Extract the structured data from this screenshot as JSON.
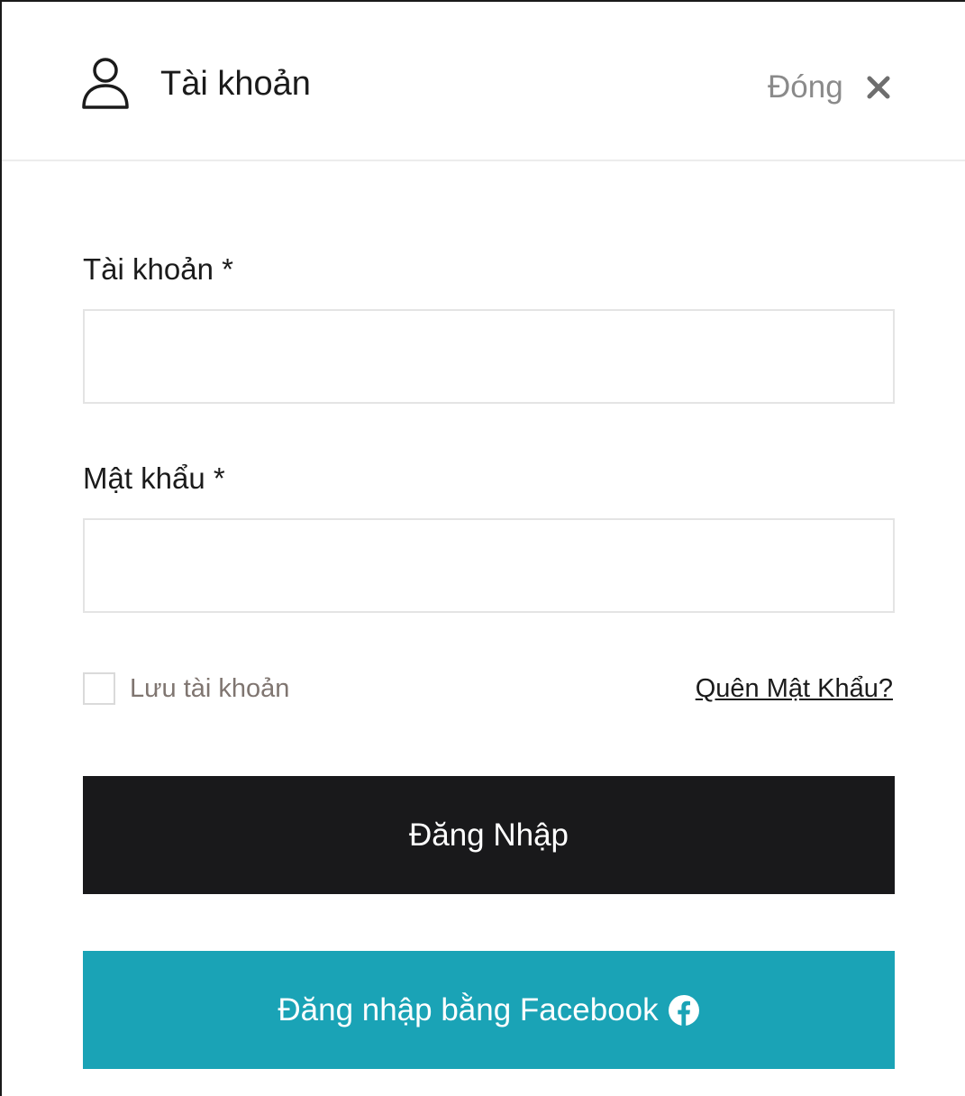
{
  "header": {
    "title": "Tài khoản",
    "close_label": "Đóng",
    "user_icon": "user-icon",
    "close_icon": "close-icon"
  },
  "form": {
    "username_label": "Tài khoản *",
    "username_value": "",
    "password_label": "Mật khẩu *",
    "password_value": "",
    "remember_label": "Lưu tài khoản",
    "remember_checked": false,
    "forgot_label": "Quên Mật Khẩu?",
    "login_button": "Đăng Nhập",
    "facebook_button": "Đăng nhập bằng Facebook",
    "facebook_icon": "facebook-icon"
  },
  "colors": {
    "login_button_bg": "#19191b",
    "facebook_button_bg": "#1aa3b6",
    "remember_text": "#7f7570",
    "close_text": "#8a8a8a"
  }
}
